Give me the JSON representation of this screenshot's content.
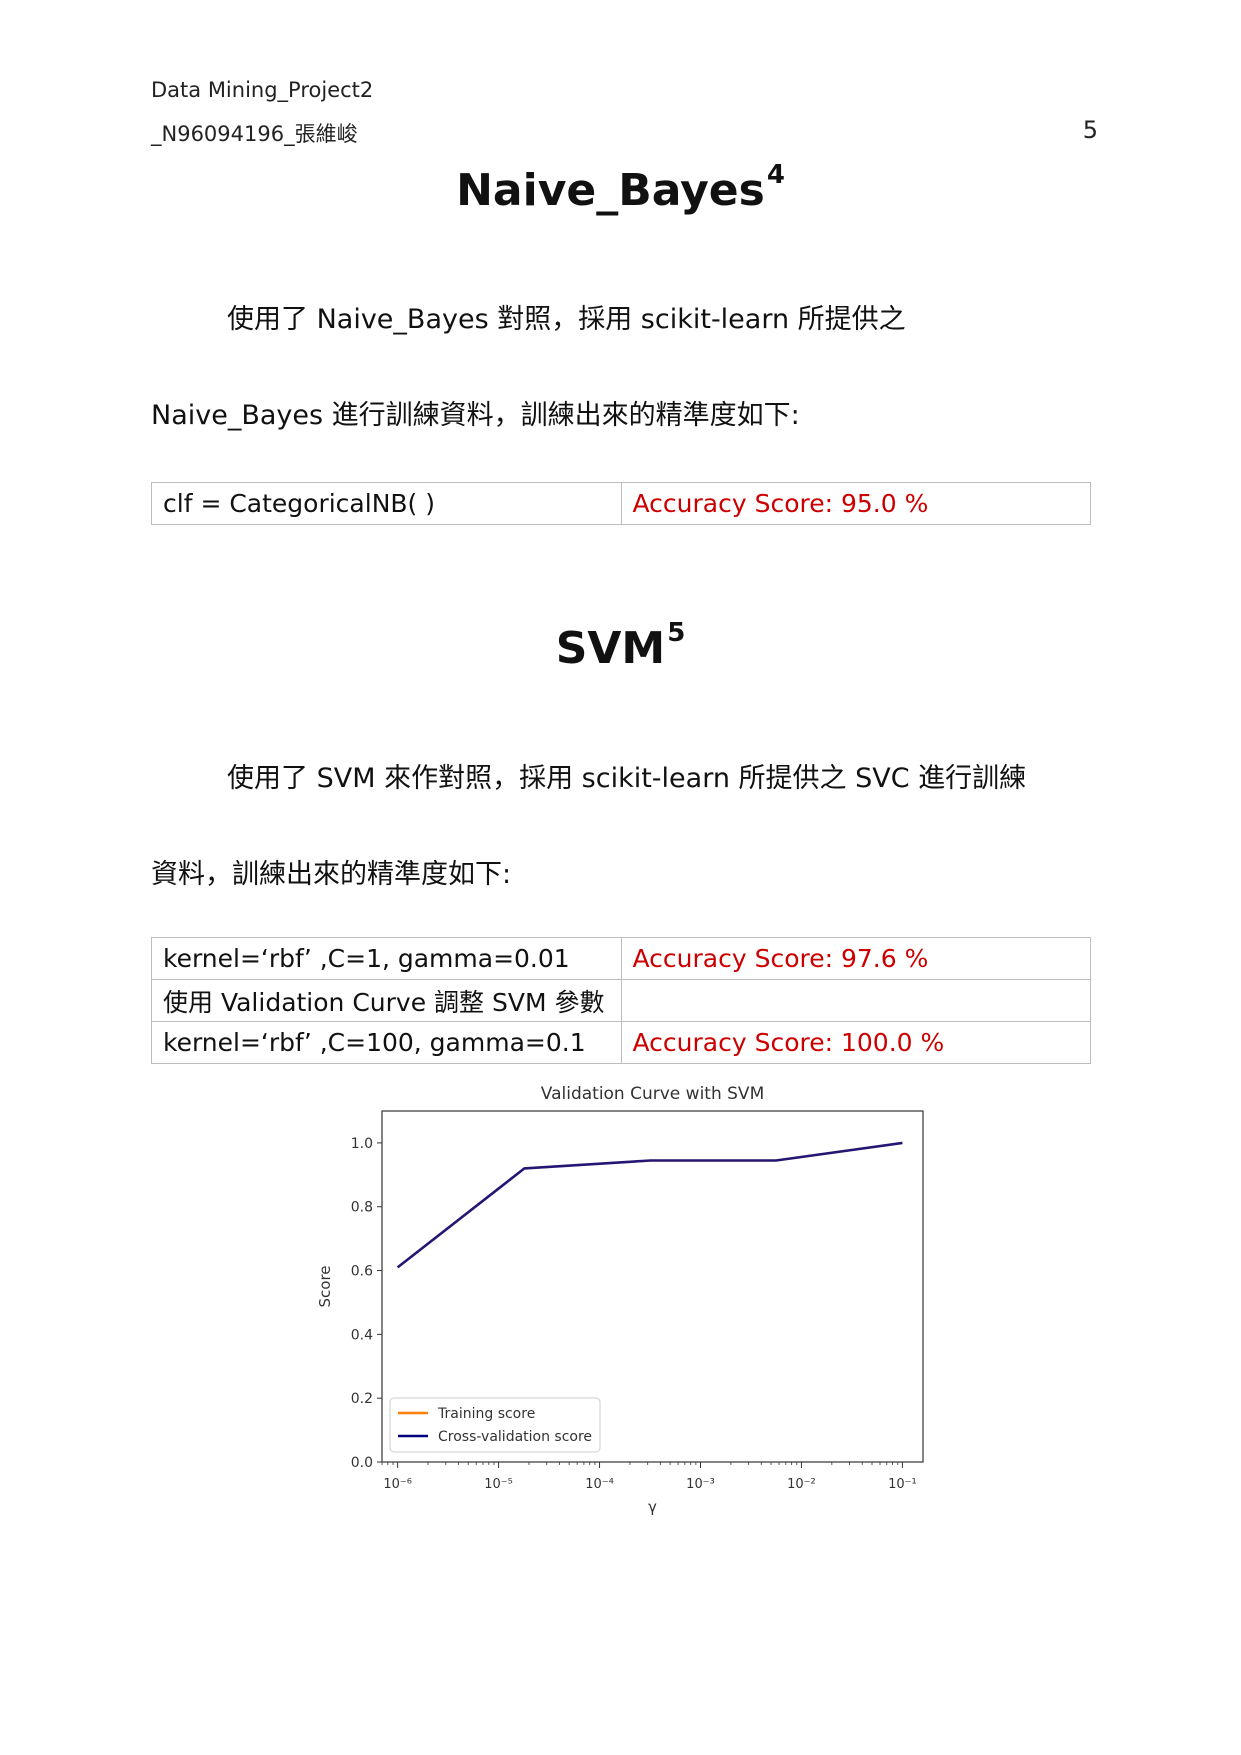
{
  "header": {
    "line1": "Data Mining_Project2",
    "line2": "_N96094196_張維峻",
    "page_number": "5"
  },
  "section1": {
    "title": "Naive_Bayes",
    "footnote": "4",
    "para_line1": "使用了 Naive_Bayes 對照，採用 scikit-learn 所提供之",
    "para_line2": "Naive_Bayes 進行訓練資料，訓練出來的精準度如下:",
    "table": [
      {
        "setting": "clf = CategoricalNB( )",
        "score": "Accuracy Score:  95.0 %"
      }
    ]
  },
  "section2": {
    "title": "SVM",
    "footnote": "5",
    "para_line1": "使用了 SVM 來作對照，採用 scikit-learn 所提供之 SVC 進行訓練",
    "para_line2": "資料，訓練出來的精準度如下:",
    "table": [
      {
        "setting": "kernel=‘rbf’ ,C=1, gamma=0.01",
        "score": "Accuracy Score:  97.6 %"
      },
      {
        "setting": "使用 Validation Curve 調整 SVM 參數",
        "score": ""
      },
      {
        "setting": "kernel=‘rbf’ ,C=100, gamma=0.1",
        "score": "Accuracy Score:  100.0 %"
      }
    ]
  },
  "chart_data": {
    "type": "line",
    "title": "Validation Curve with SVM",
    "xlabel": "γ",
    "ylabel": "Score",
    "xscale": "log",
    "xlim": [
      7e-07,
      0.16
    ],
    "ylim": [
      0.0,
      1.1
    ],
    "xticks": [
      1e-06,
      1e-05,
      0.0001,
      0.001,
      0.01,
      0.1
    ],
    "xtick_labels": [
      "10⁻⁶",
      "10⁻⁵",
      "10⁻⁴",
      "10⁻³",
      "10⁻²",
      "10⁻¹"
    ],
    "yticks": [
      0.0,
      0.2,
      0.4,
      0.6,
      0.8,
      1.0
    ],
    "ytick_labels": [
      "0.0",
      "0.2",
      "0.4",
      "0.6",
      "0.8",
      "1.0"
    ],
    "x": [
      1e-06,
      1.8e-05,
      0.00032,
      0.0056,
      0.1
    ],
    "series": [
      {
        "name": "Training score",
        "color": "#ff7f0e",
        "values": [
          0.61,
          0.92,
          0.945,
          0.945,
          1.0
        ]
      },
      {
        "name": "Cross-validation score",
        "color": "#000080",
        "values": [
          0.61,
          0.92,
          0.945,
          0.945,
          1.0
        ]
      }
    ],
    "legend_position": "lower-left",
    "grid": false
  }
}
